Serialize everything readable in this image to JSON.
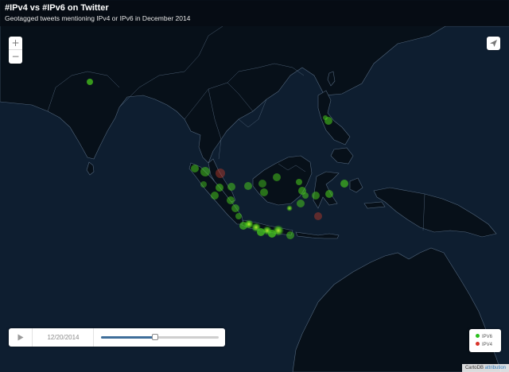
{
  "header": {
    "title": "#IPv4 vs #IPv6 on Twitter",
    "subtitle": "Geotagged tweets mentioning IPv4 or IPv6 in December 2014"
  },
  "zoom": {
    "in_label": "+",
    "out_label": "−"
  },
  "timeline": {
    "date": "12/20/2014",
    "progress": 0.46
  },
  "legend": {
    "items": [
      {
        "label": "IPV6",
        "color": "#2bbf1e"
      },
      {
        "label": "IPV4",
        "color": "#d9342b"
      }
    ]
  },
  "attribution": {
    "prefix": "CartoDB",
    "link": "attribution"
  },
  "colors": {
    "sea": "#0e1e30",
    "land": "#071019",
    "border": "#5a6f86",
    "ipv6": "#4bd41c",
    "ipv4": "#c23b2b"
  },
  "icons": {
    "zoom_in": "plus-icon",
    "zoom_out": "minus-icon",
    "share": "paper-plane-icon",
    "play": "play-icon"
  }
}
